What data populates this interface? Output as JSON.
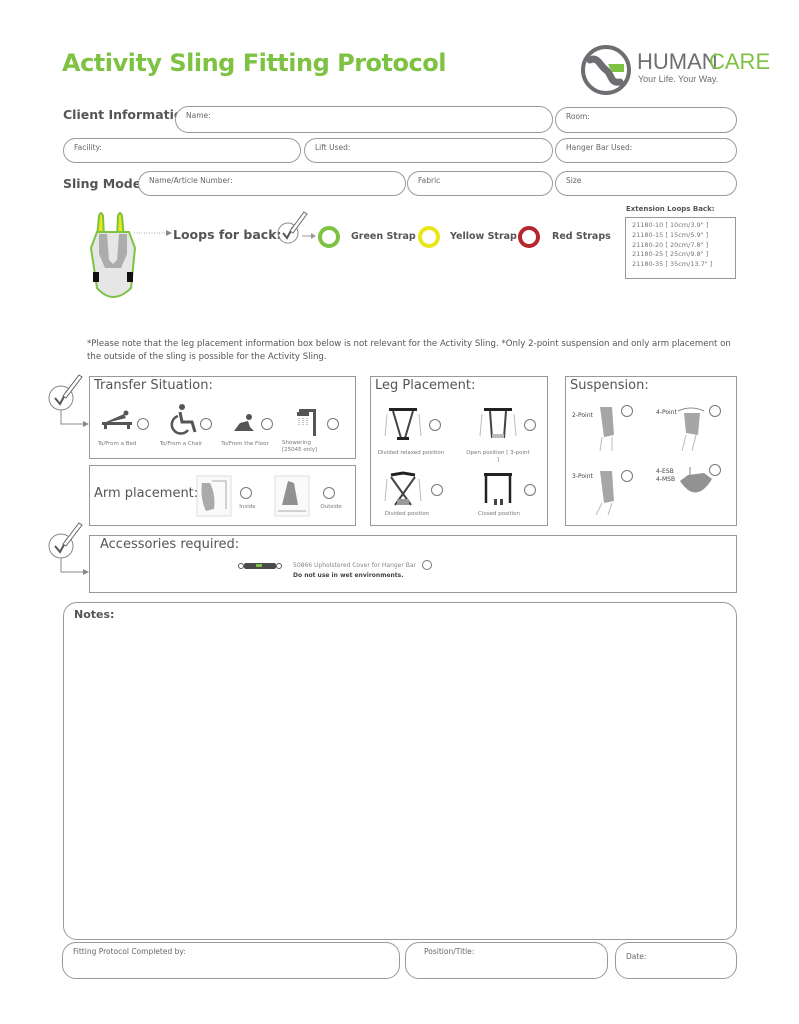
{
  "header": {
    "title": "Activity Sling Fitting Protocol",
    "logo": {
      "brand_part1": "HUMAN",
      "brand_part2": "CARE",
      "tagline": "Your Life. Your Way.",
      "icon": "human-care-logo-icon"
    }
  },
  "colors": {
    "brand_green": "#7dc242",
    "strap_green": "#7dc242",
    "strap_yellow": "#e8e61a",
    "strap_red": "#b5262e",
    "text_gray": "#555555"
  },
  "client_information": {
    "section_label": "Client Information:",
    "name_label": "Name:",
    "room_label": "Room:",
    "facility_label": "Facility:",
    "lift_used_label": "Lift Used:",
    "hanger_bar_label": "Hanger Bar Used:"
  },
  "sling_model": {
    "section_label": "Sling Model:",
    "article_label": "Name/Article Number:",
    "fabric_label": "Fabric",
    "size_label": "Size"
  },
  "loops": {
    "label": "Loops for back:",
    "straps": [
      {
        "label": "Green Strap",
        "color": "#7dc242"
      },
      {
        "label": "Yellow Strap",
        "color": "#e8e61a"
      },
      {
        "label": "Red Straps",
        "color": "#b5262e"
      }
    ],
    "extension_title": "Extension Loops Back:",
    "extension_items": [
      "21180-10 [ 10cm/3.9\" ]",
      "21180-15 [ 15cm/5.9\" ]",
      "21180-20 [ 20cm/7.8\" ]",
      "21180-25 [ 25cm/9.8\" ]",
      "21180-35 [ 35cm/13.7\" ]"
    ]
  },
  "note_text": "*Please note that the leg placement information box below is not relevant for the Activity Sling. *Only 2-point suspension and only arm placement on the outside of the sling is possible for the Activity Sling.",
  "transfer": {
    "title": "Transfer Situation:",
    "options": [
      {
        "label": "To/From a Bed",
        "icon": "bed-transfer-icon"
      },
      {
        "label": "To/From a Chair",
        "icon": "wheelchair-icon"
      },
      {
        "label": "To/From the Floor",
        "icon": "floor-sitting-icon"
      },
      {
        "label": "Showering [25045 only]",
        "icon": "shower-icon"
      }
    ]
  },
  "arm_placement": {
    "title": "Arm placement:",
    "options": [
      {
        "label": "Inside"
      },
      {
        "label": "Outside"
      }
    ]
  },
  "leg_placement": {
    "title": "Leg Placement:",
    "options": [
      {
        "label": "Divided relaxed position"
      },
      {
        "label": "Open position [ 3-point ]"
      },
      {
        "label": "Divided position"
      },
      {
        "label": "Closed position"
      }
    ]
  },
  "suspension": {
    "title": "Suspension:",
    "options": [
      {
        "label": "2-Point"
      },
      {
        "label": "4-Point"
      },
      {
        "label": "3-Point"
      },
      {
        "label": "4-ESB\n4-MSB"
      }
    ]
  },
  "accessories": {
    "title": "Accessories required:",
    "item_label": "50866 Upholstered Cover for Hanger Bar",
    "warning": "Do not use in wet environments."
  },
  "notes": {
    "label": "Notes:"
  },
  "footer": {
    "completed_by_label": "Fitting Protocol Completed by:",
    "position_label": "Position/Title:",
    "date_label": "Date:"
  }
}
